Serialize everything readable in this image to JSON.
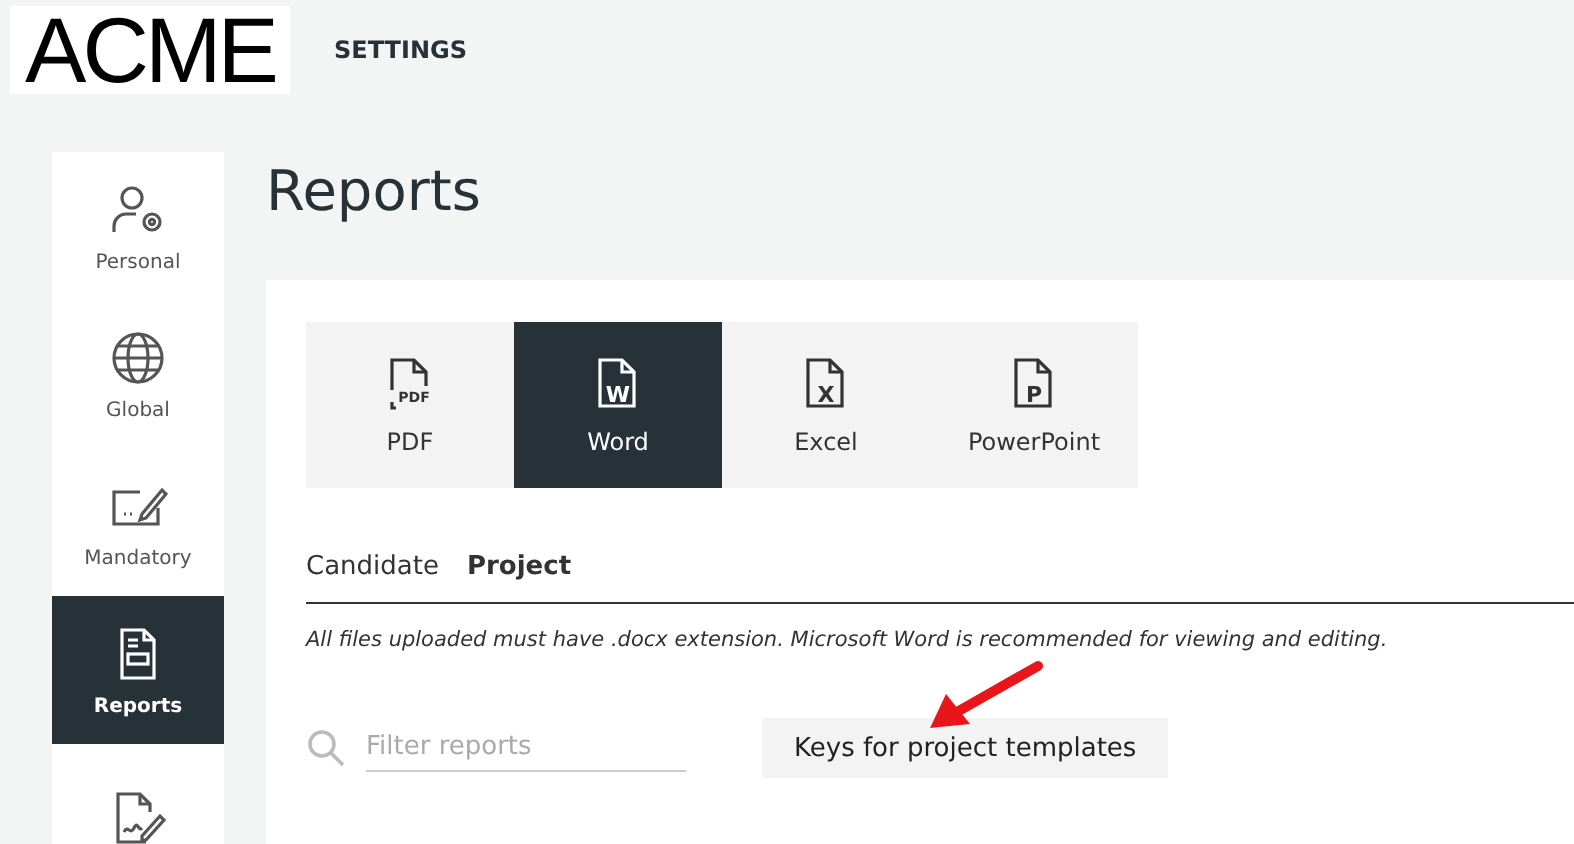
{
  "header": {
    "logo": "ACME",
    "title": "SETTINGS"
  },
  "sidebar": {
    "items": [
      {
        "kind": "personal",
        "label": "Personal",
        "selected": false
      },
      {
        "kind": "global",
        "label": "Global",
        "selected": false
      },
      {
        "kind": "mandatory",
        "label": "Mandatory",
        "selected": false
      },
      {
        "kind": "reports",
        "label": "Reports",
        "selected": true
      },
      {
        "kind": "signature",
        "selected": false
      }
    ]
  },
  "page_title": "Reports",
  "formats": [
    {
      "icon_text": "PDF",
      "label": "PDF",
      "selected": false
    },
    {
      "icon_text": "W",
      "label": "Word",
      "selected": true
    },
    {
      "icon_text": "X",
      "label": "Excel",
      "selected": false
    },
    {
      "icon_text": "P",
      "label": "PowerPoint",
      "selected": false
    }
  ],
  "tabs": [
    {
      "label": "Candidate",
      "selected": false
    },
    {
      "label": "Project",
      "selected": true
    }
  ],
  "note": "All files uploaded must have .docx extension. Microsoft Word is recommended for viewing and editing.",
  "filter": {
    "placeholder": "Filter reports"
  },
  "keys_button": "Keys for project templates"
}
